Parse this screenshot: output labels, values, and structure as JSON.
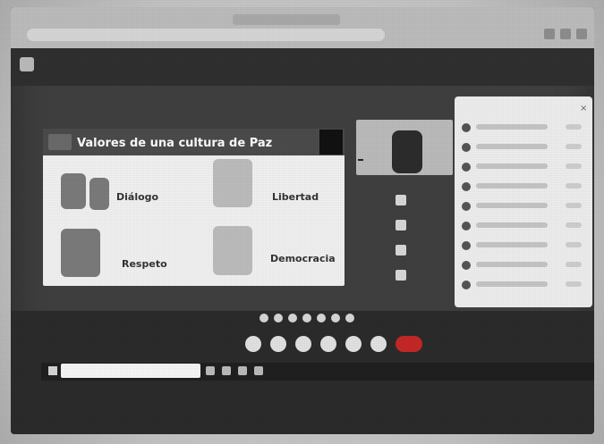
{
  "browser": {
    "title": "",
    "address": ""
  },
  "meet": {
    "title": ""
  },
  "slide": {
    "title": "Valores de una cultura de Paz",
    "badge": "",
    "values": [
      "Diálogo",
      "Libertad",
      "Respeto",
      "Democracia"
    ]
  },
  "people_panel": {
    "title": "",
    "close_icon": "close-icon"
  },
  "video": {
    "label": ""
  },
  "bottom": {
    "meeting_time": "",
    "right_status": ""
  },
  "taskbar": {
    "time": ""
  },
  "colors": {
    "accent": "#c62828",
    "header": "#4b4b4b",
    "panel": "#efefef"
  }
}
